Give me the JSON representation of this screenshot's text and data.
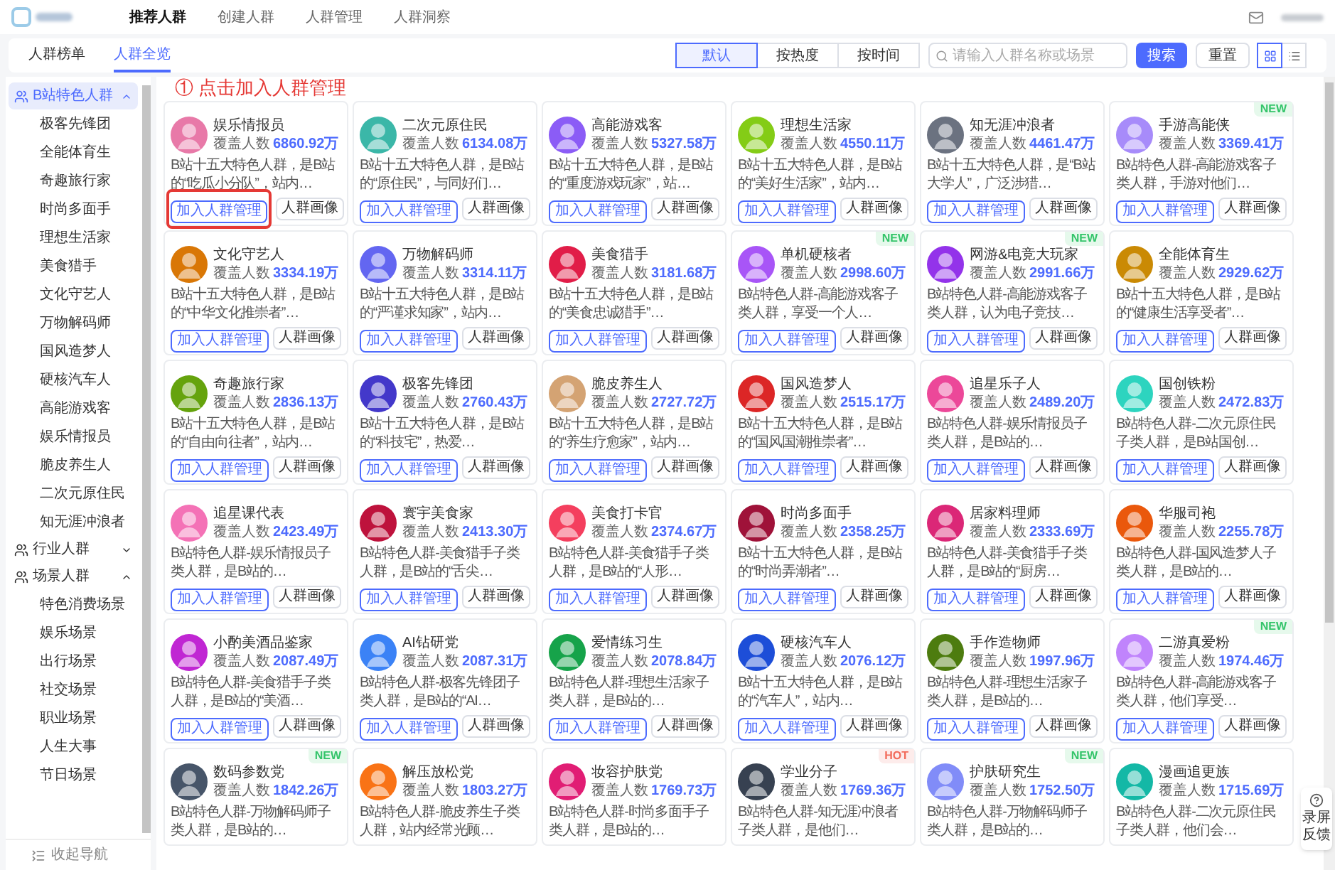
{
  "top_nav": {
    "items": [
      {
        "label": "推荐人群",
        "selected": true
      },
      {
        "label": "创建人群",
        "selected": false
      },
      {
        "label": "人群管理",
        "selected": false
      },
      {
        "label": "人群洞察",
        "selected": false
      }
    ]
  },
  "sub_tabs": [
    {
      "label": "人群榜单",
      "selected": false
    },
    {
      "label": "人群全览",
      "selected": true
    }
  ],
  "sort_options": [
    {
      "label": "默认",
      "selected": true
    },
    {
      "label": "按热度",
      "selected": false
    },
    {
      "label": "按时间",
      "selected": false
    }
  ],
  "search": {
    "placeholder": "请输入人群名称或场景"
  },
  "search_button": "搜索",
  "reset_button": "重置",
  "view_toggle": [
    {
      "kind": "grid",
      "selected": true
    },
    {
      "kind": "list",
      "selected": false
    }
  ],
  "annotation": "① 点击加入人群管理",
  "sidebar": {
    "groups": [
      {
        "label": "B站特色人群",
        "selected": true,
        "expanded": true,
        "children": [
          {
            "label": "极客先锋团"
          },
          {
            "label": "全能体育生"
          },
          {
            "label": "奇趣旅行家"
          },
          {
            "label": "时尚多面手"
          },
          {
            "label": "理想生活家"
          },
          {
            "label": "美食猎手"
          },
          {
            "label": "文化守艺人"
          },
          {
            "label": "万物解码师"
          },
          {
            "label": "国风造梦人"
          },
          {
            "label": "硬核汽车人"
          },
          {
            "label": "高能游戏客"
          },
          {
            "label": "娱乐情报员"
          },
          {
            "label": "脆皮养生人"
          },
          {
            "label": "二次元原住民"
          },
          {
            "label": "知无涯冲浪者"
          }
        ]
      },
      {
        "label": "行业人群",
        "selected": false,
        "expanded": false
      },
      {
        "label": "场景人群",
        "selected": false,
        "expanded": true,
        "children": [
          {
            "label": "特色消费场景"
          },
          {
            "label": "娱乐场景"
          },
          {
            "label": "出行场景"
          },
          {
            "label": "社交场景"
          },
          {
            "label": "职业场景"
          },
          {
            "label": "人生大事"
          },
          {
            "label": "节日场景"
          }
        ]
      }
    ],
    "collapse": "收起导航"
  },
  "cards": [
    {
      "name": "娱乐情报员",
      "count_label": "覆盖人数",
      "count": "6860.92万",
      "color": "#e879a8",
      "desc": "B站十五大特色人群，是B站的“吃瓜小分队”，站内…",
      "buttons": [
        "加入人群管理",
        "人群画像"
      ],
      "highlighted": true
    },
    {
      "name": "二次元原住民",
      "count_label": "覆盖人数",
      "count": "6134.08万",
      "color": "#3bb7a8",
      "desc": "B站十五大特色人群，是B站的“原住民”，与同好们…",
      "buttons": [
        "加入人群管理",
        "人群画像"
      ]
    },
    {
      "name": "高能游戏客",
      "count_label": "覆盖人数",
      "count": "5327.58万",
      "color": "#8b5cf6",
      "desc": "B站十五大特色人群，是B站的“重度游戏玩家”，站…",
      "buttons": [
        "加入人群管理",
        "人群画像"
      ]
    },
    {
      "name": "理想生活家",
      "count_label": "覆盖人数",
      "count": "4550.11万",
      "color": "#84cc16",
      "desc": "B站十五大特色人群，是B站的“美好生活家”，站内…",
      "buttons": [
        "加入人群管理",
        "人群画像"
      ]
    },
    {
      "name": "知无涯冲浪者",
      "count_label": "覆盖人数",
      "count": "4461.47万",
      "color": "#6b7280",
      "desc": "B站十五大特色人群，是“B站大学人”，广泛涉猎…",
      "buttons": [
        "加入人群管理",
        "人群画像"
      ]
    },
    {
      "name": "手游高能侠",
      "count_label": "覆盖人数",
      "count": "3369.41万",
      "color": "#a78bfa",
      "desc": "B站特色人群-高能游戏客子类人群，手游对他们…",
      "buttons": [
        "加入人群管理",
        "人群画像"
      ],
      "badge": {
        "text": "NEW",
        "kind": "new"
      }
    },
    {
      "name": "文化守艺人",
      "count_label": "覆盖人数",
      "count": "3334.19万",
      "color": "#d97706",
      "desc": "B站十五大特色人群，是B站的“中华文化推崇者”…",
      "buttons": [
        "加入人群管理",
        "人群画像"
      ]
    },
    {
      "name": "万物解码师",
      "count_label": "覆盖人数",
      "count": "3314.11万",
      "color": "#6366f1",
      "desc": "B站十五大特色人群，是B站的“严谨求知家”，站内…",
      "buttons": [
        "加入人群管理",
        "人群画像"
      ]
    },
    {
      "name": "美食猎手",
      "count_label": "覆盖人数",
      "count": "3181.68万",
      "color": "#e11d48",
      "desc": "B站十五大特色人群，是B站的“美食忠诚猎手”…",
      "buttons": [
        "加入人群管理",
        "人群画像"
      ]
    },
    {
      "name": "单机硬核者",
      "count_label": "覆盖人数",
      "count": "2998.60万",
      "color": "#a855f7",
      "desc": "B站特色人群-高能游戏客子类人群，享受一个人…",
      "buttons": [
        "加入人群管理",
        "人群画像"
      ],
      "badge": {
        "text": "NEW",
        "kind": "new"
      }
    },
    {
      "name": "网游&电竞大玩家",
      "count_label": "覆盖人数",
      "count": "2991.66万",
      "color": "#9333ea",
      "desc": "B站特色人群-高能游戏客子类人群，认为电子竞技…",
      "buttons": [
        "加入人群管理",
        "人群画像"
      ],
      "badge": {
        "text": "NEW",
        "kind": "new"
      }
    },
    {
      "name": "全能体育生",
      "count_label": "覆盖人数",
      "count": "2929.62万",
      "color": "#ca8a04",
      "desc": "B站十五大特色人群，是B站的“健康生活享受者”…",
      "buttons": [
        "加入人群管理",
        "人群画像"
      ]
    },
    {
      "name": "奇趣旅行家",
      "count_label": "覆盖人数",
      "count": "2836.13万",
      "color": "#65a30d",
      "desc": "B站十五大特色人群，是B站的“自由向往者”，站内…",
      "buttons": [
        "加入人群管理",
        "人群画像"
      ]
    },
    {
      "name": "极客先锋团",
      "count_label": "覆盖人数",
      "count": "2760.43万",
      "color": "#4338ca",
      "desc": "B站十五大特色人群，是B站的“科技宅”，热爱…",
      "buttons": [
        "加入人群管理",
        "人群画像"
      ]
    },
    {
      "name": "脆皮养生人",
      "count_label": "覆盖人数",
      "count": "2727.72万",
      "color": "#d4a373",
      "desc": "B站十五大特色人群，是B站的“养生疗愈家”，站内…",
      "buttons": [
        "加入人群管理",
        "人群画像"
      ]
    },
    {
      "name": "国风造梦人",
      "count_label": "覆盖人数",
      "count": "2515.17万",
      "color": "#dc2626",
      "desc": "B站十五大特色人群，是B站的“国风国潮推崇者”…",
      "buttons": [
        "加入人群管理",
        "人群画像"
      ]
    },
    {
      "name": "追星乐子人",
      "count_label": "覆盖人数",
      "count": "2489.20万",
      "color": "#ec4899",
      "desc": "B站特色人群-娱乐情报员子类人群，是B站的…",
      "buttons": [
        "加入人群管理",
        "人群画像"
      ]
    },
    {
      "name": "国创铁粉",
      "count_label": "覆盖人数",
      "count": "2472.83万",
      "color": "#2dd4bf",
      "desc": "B站特色人群-二次元原住民子类人群，是B站国创…",
      "buttons": [
        "加入人群管理",
        "人群画像"
      ]
    },
    {
      "name": "追星课代表",
      "count_label": "覆盖人数",
      "count": "2423.49万",
      "color": "#f472b6",
      "desc": "B站特色人群-娱乐情报员子类人群，是B站的…",
      "buttons": [
        "加入人群管理",
        "人群画像"
      ]
    },
    {
      "name": "寰宇美食家",
      "count_label": "覆盖人数",
      "count": "2413.30万",
      "color": "#be123c",
      "desc": "B站特色人群-美食猎手子类人群，是B站的“舌尖…",
      "buttons": [
        "加入人群管理",
        "人群画像"
      ]
    },
    {
      "name": "美食打卡官",
      "count_label": "覆盖人数",
      "count": "2374.67万",
      "color": "#f43f5e",
      "desc": "B站特色人群-美食猎手子类人群，是B站的“人形…",
      "buttons": [
        "加入人群管理",
        "人群画像"
      ]
    },
    {
      "name": "时尚多面手",
      "count_label": "覆盖人数",
      "count": "2358.25万",
      "color": "#9f1239",
      "desc": "B站十五大特色人群，是B站的“时尚弄潮者”…",
      "buttons": [
        "加入人群管理",
        "人群画像"
      ]
    },
    {
      "name": "居家料理师",
      "count_label": "覆盖人数",
      "count": "2333.69万",
      "color": "#db2777",
      "desc": "B站特色人群-美食猎手子类人群，是B站的“厨房…",
      "buttons": [
        "加入人群管理",
        "人群画像"
      ]
    },
    {
      "name": "华服司袍",
      "count_label": "覆盖人数",
      "count": "2255.78万",
      "color": "#ea580c",
      "desc": "B站特色人群-国风造梦人子类人群，是B站的…",
      "buttons": [
        "加入人群管理",
        "人群画像"
      ]
    },
    {
      "name": "小酌美酒品鉴家",
      "count_label": "覆盖人数",
      "count": "2087.49万",
      "color": "#c026d3",
      "desc": "B站特色人群-美食猎手子类人群，是B站的“美酒…",
      "buttons": [
        "加入人群管理",
        "人群画像"
      ]
    },
    {
      "name": "AI钻研党",
      "count_label": "覆盖人数",
      "count": "2087.31万",
      "color": "#3b82f6",
      "desc": "B站特色人群-极客先锋团子类人群，是B站的“AI…",
      "buttons": [
        "加入人群管理",
        "人群画像"
      ]
    },
    {
      "name": "爱情练习生",
      "count_label": "覆盖人数",
      "count": "2078.84万",
      "color": "#16a34a",
      "desc": "B站特色人群-理想生活家子类人群，是B站的…",
      "buttons": [
        "加入人群管理",
        "人群画像"
      ]
    },
    {
      "name": "硬核汽车人",
      "count_label": "覆盖人数",
      "count": "2076.12万",
      "color": "#1d4ed8",
      "desc": "B站十五大特色人群，是B站的“汽车人”，站内…",
      "buttons": [
        "加入人群管理",
        "人群画像"
      ]
    },
    {
      "name": "手作造物师",
      "count_label": "覆盖人数",
      "count": "1997.96万",
      "color": "#4d7c0f",
      "desc": "B站特色人群-理想生活家子类人群，是B站的…",
      "buttons": [
        "加入人群管理",
        "人群画像"
      ]
    },
    {
      "name": "二游真爱粉",
      "count_label": "覆盖人数",
      "count": "1974.46万",
      "color": "#c084fc",
      "desc": "B站特色人群-高能游戏客子类人群，他们享受…",
      "buttons": [
        "加入人群管理",
        "人群画像"
      ],
      "badge": {
        "text": "NEW",
        "kind": "new"
      }
    },
    {
      "name": "数码参数党",
      "count_label": "覆盖人数",
      "count": "1842.26万",
      "color": "#475569",
      "desc": "B站特色人群-万物解码师子类人群，是B站的…",
      "badge": {
        "text": "NEW",
        "kind": "new"
      }
    },
    {
      "name": "解压放松党",
      "count_label": "覆盖人数",
      "count": "1803.27万",
      "color": "#f97316",
      "desc": "B站特色人群-脆皮养生子类人群，站内经常光顾…"
    },
    {
      "name": "妆容护肤党",
      "count_label": "覆盖人数",
      "count": "1769.73万",
      "color": "#e11d74",
      "desc": "B站特色人群-时尚多面手子类人群，是B站的…"
    },
    {
      "name": "学业分子",
      "count_label": "覆盖人数",
      "count": "1769.36万",
      "color": "#374151",
      "desc": "B站特色人群-知无涯冲浪者子类人群，是他们…",
      "badge": {
        "text": "HOT",
        "kind": "hot"
      }
    },
    {
      "name": "护肤研究生",
      "count_label": "覆盖人数",
      "count": "1752.50万",
      "color": "#818cf8",
      "desc": "B站特色人群-万物解码师子类人群，是B站的…",
      "badge": {
        "text": "NEW",
        "kind": "new"
      }
    },
    {
      "name": "漫画追更族",
      "count_label": "覆盖人数",
      "count": "1715.69万",
      "color": "#14b8a6",
      "desc": "B站特色人群-二次元原住民子类人群，他们会…"
    }
  ],
  "feedback": {
    "label": "录屏反馈"
  }
}
